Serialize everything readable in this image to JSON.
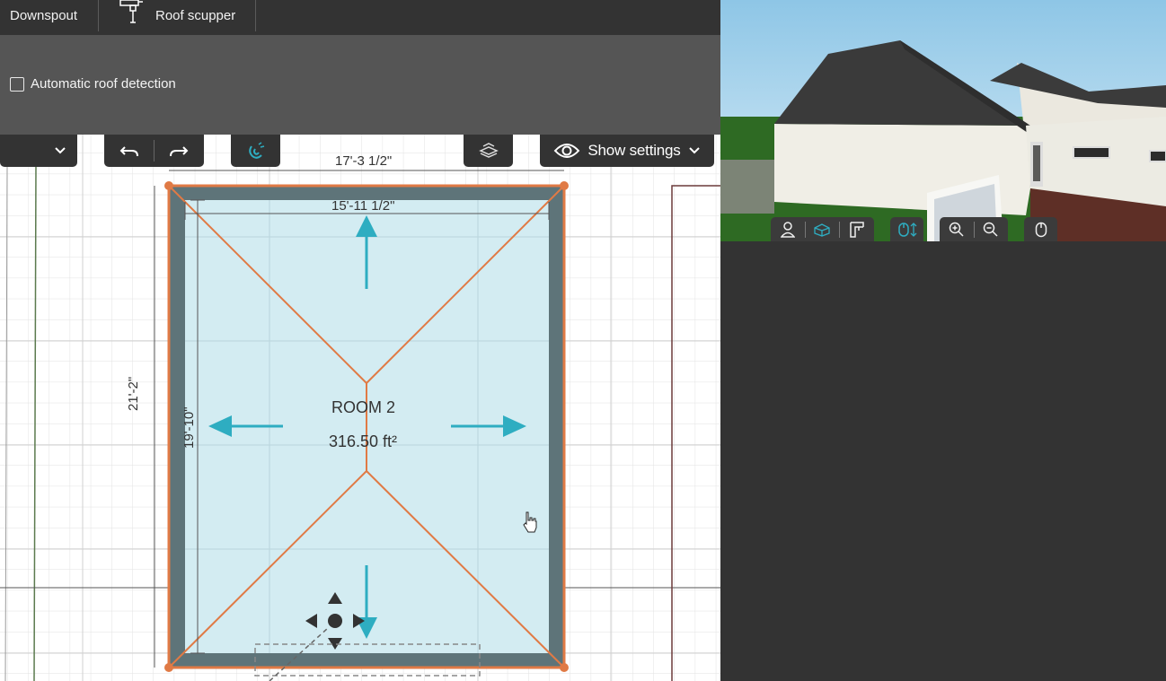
{
  "top_tabs": [
    {
      "label": "Downspout"
    },
    {
      "label": "Roof scupper"
    }
  ],
  "options": {
    "auto_roof_label": "Automatic roof detection",
    "auto_roof_checked": false
  },
  "toolbar": {
    "show_settings_label": "Show settings"
  },
  "plan": {
    "room_name": "ROOM 2",
    "room_area": "316.50 ft²",
    "dim_outer_width": "17'-3 1/2\"",
    "dim_inner_width": "15'-11 1/2\"",
    "dim_outer_height": "21'-2\"",
    "dim_inner_height": "19'-10\"",
    "wall_color": "#5e7479",
    "roof_line_color": "#e07a45",
    "room_fill_color": "#d3ecf2",
    "arrow_color": "#2eadc1"
  },
  "view3d_buttons": [
    {
      "icon": "person-view-icon"
    },
    {
      "icon": "3d-box-view-icon"
    },
    {
      "icon": "floor-plan-view-icon"
    },
    {
      "icon": "mouse-vertical-move-icon"
    },
    {
      "icon": "zoom-in-icon"
    },
    {
      "icon": "zoom-out-icon"
    },
    {
      "icon": "mouse-icon"
    }
  ]
}
